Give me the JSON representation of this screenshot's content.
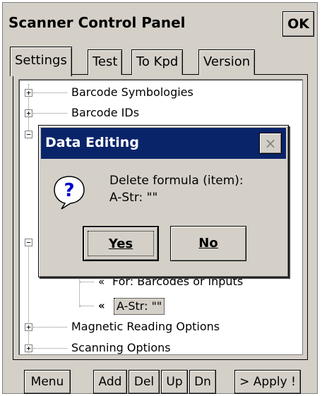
{
  "window": {
    "title": "Scanner Control Panel",
    "ok_label": "OK"
  },
  "tabs": [
    {
      "label": "Settings",
      "active": true
    },
    {
      "label": "Test",
      "active": false
    },
    {
      "label": "To Kpd",
      "active": false
    },
    {
      "label": "Version",
      "active": false
    }
  ],
  "tree": {
    "items": [
      {
        "label": "Barcode Symbologies",
        "expander": "+"
      },
      {
        "label": "Barcode IDs",
        "expander": "+"
      },
      {
        "label": "For: Barcodes or inputs",
        "expander": ""
      },
      {
        "label": "A-Str: \"\"",
        "expander": "",
        "selected": true
      },
      {
        "label": "Magnetic Reading Options",
        "expander": "+"
      },
      {
        "label": "Scanning Options",
        "expander": "+"
      }
    ],
    "item_icon": "double-chevron-left-icon"
  },
  "toolbar": {
    "menu": "Menu",
    "add": "Add",
    "del": "Del",
    "up": "Up",
    "dn": "Dn",
    "apply": "> Apply !"
  },
  "dialog": {
    "title": "Data Editing",
    "close_glyph": "×",
    "message_line1": "Delete formula (item):",
    "message_line2": "A-Str: \"\"",
    "yes_label": "Yes",
    "no_label": "No",
    "icon": "question-icon"
  },
  "colors": {
    "titlebar_active": "#0a246a",
    "face": "#d4d0c8",
    "window_bg": "#ffffff"
  }
}
